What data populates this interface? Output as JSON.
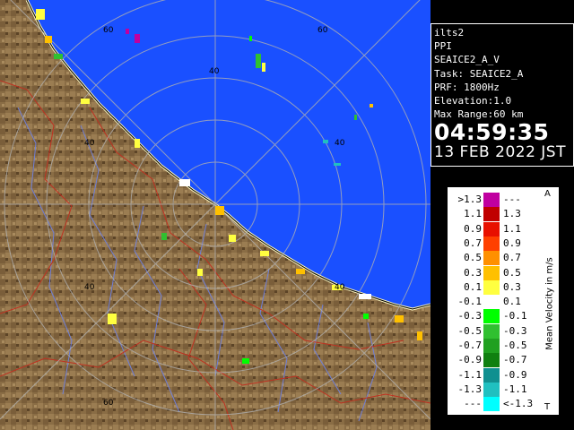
{
  "radar": {
    "site": "ilts2",
    "scan_type": "PPI",
    "product": "SEAICE2_A_V",
    "task": "Task: SEAICE2_A",
    "prf": "PRF: 1800Hz",
    "elevation": "Elevation:1.0",
    "max_range": "Max Range:60 km",
    "time": "04:59:35",
    "date": "13 FEB 2022 JST"
  },
  "map": {
    "ring_labels": [
      "60",
      "60",
      "40",
      "40",
      "40",
      "40",
      "40",
      "60"
    ],
    "sea_color": "#1a50ff",
    "land_color": "#8a6d45",
    "ring_color": "#b0b0b0"
  },
  "legend": {
    "title": "Mean Velocity in m/s",
    "top_marker": "A",
    "bottom_marker": "T",
    "rows": [
      {
        "left": ">1.3",
        "right": "---",
        "color": "#c000a0"
      },
      {
        "left": "1.1",
        "right": "1.3",
        "color": "#c00000"
      },
      {
        "left": "0.9",
        "right": "1.1",
        "color": "#e81000"
      },
      {
        "left": "0.7",
        "right": "0.9",
        "color": "#ff4000"
      },
      {
        "left": "0.5",
        "right": "0.7",
        "color": "#ff9000"
      },
      {
        "left": "0.3",
        "right": "0.5",
        "color": "#ffc000"
      },
      {
        "left": "0.1",
        "right": "0.3",
        "color": "#ffff40"
      },
      {
        "left": "-0.1",
        "right": "0.1",
        "color": "#ffffff"
      },
      {
        "left": "-0.3",
        "right": "-0.1",
        "color": "#00ff00"
      },
      {
        "left": "-0.5",
        "right": "-0.3",
        "color": "#30c030"
      },
      {
        "left": "-0.7",
        "right": "-0.5",
        "color": "#20a020"
      },
      {
        "left": "-0.9",
        "right": "-0.7",
        "color": "#108010"
      },
      {
        "left": "-1.1",
        "right": "-0.9",
        "color": "#109090"
      },
      {
        "left": "-1.3",
        "right": "-1.1",
        "color": "#20c0c0"
      },
      {
        "left": "---",
        "right": "<-1.3",
        "color": "#00ffff"
      }
    ]
  }
}
